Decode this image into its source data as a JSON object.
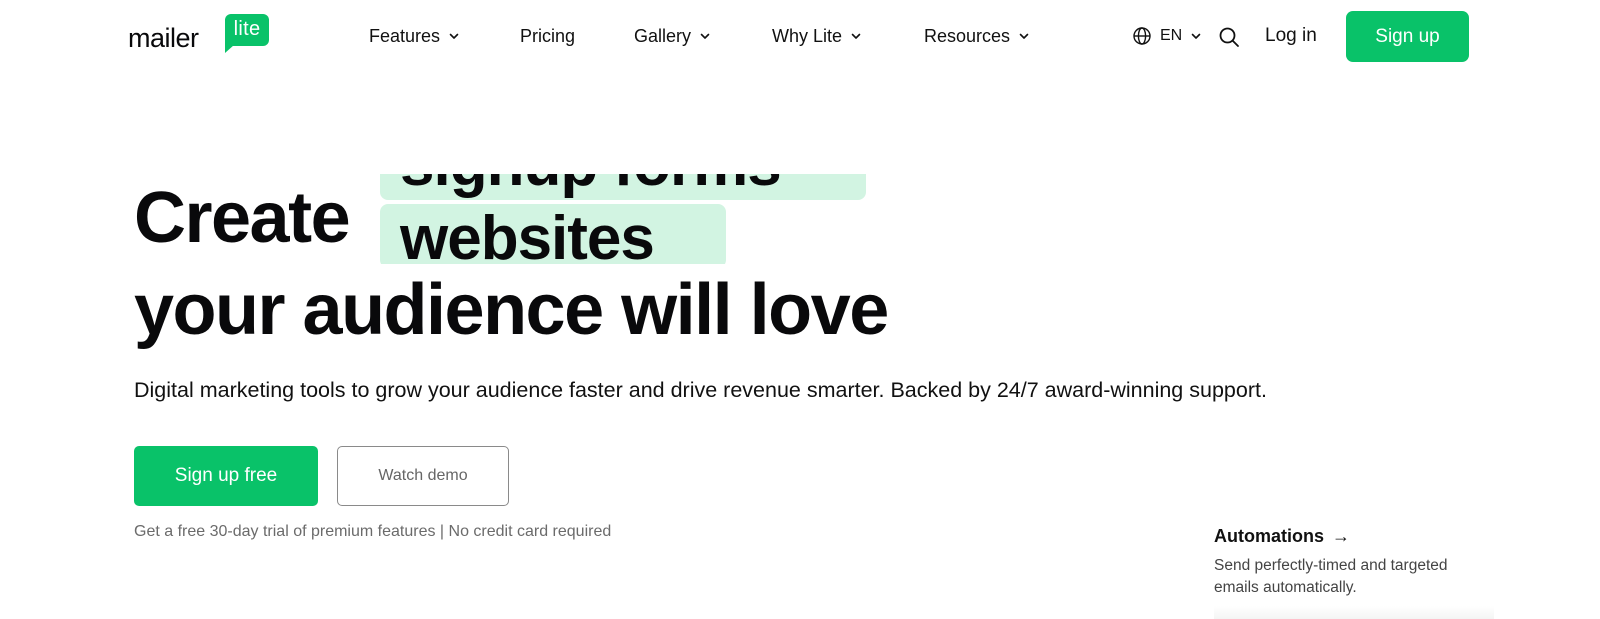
{
  "header": {
    "logo": {
      "word": "mailer",
      "badge": "lite"
    },
    "nav": [
      {
        "label": "Features",
        "dropdown": true
      },
      {
        "label": "Pricing",
        "dropdown": false
      },
      {
        "label": "Gallery",
        "dropdown": true
      },
      {
        "label": "Why Lite",
        "dropdown": true
      },
      {
        "label": "Resources",
        "dropdown": true
      }
    ],
    "language": "EN",
    "login_label": "Log in",
    "signup_label": "Sign up"
  },
  "hero": {
    "title_start": "Create",
    "rotating_words": [
      "signup forms",
      "websites"
    ],
    "title_end": "your audience will love",
    "subtitle": "Digital marketing tools to grow your audience faster and drive revenue smarter. Backed by 24/7 award-winning support.",
    "primary_cta": "Sign up free",
    "secondary_cta": "Watch demo",
    "trial_note": "Get a free 30-day trial of premium features | No credit card required"
  },
  "feature_card": {
    "title": "Automations",
    "arrow": "→",
    "description": "Send perfectly-timed and targeted emails automatically."
  },
  "colors": {
    "brand_green": "#09c269",
    "highlight_mint": "#d2f4e2",
    "text_dark": "#09090b"
  },
  "icons": [
    "chevron-down-icon",
    "globe-icon",
    "search-icon",
    "arrow-right-icon"
  ]
}
